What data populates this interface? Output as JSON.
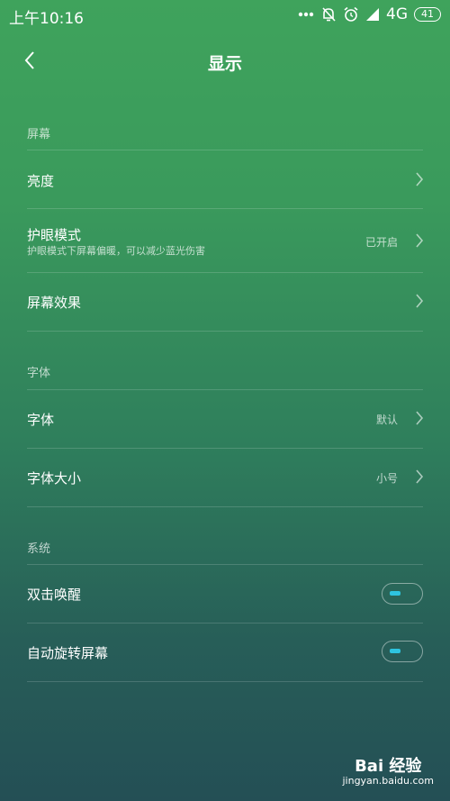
{
  "status_bar": {
    "time": "上午10:16",
    "network": "4G",
    "battery": "41",
    "icons": [
      "more-icon",
      "notification-off-icon",
      "alarm-icon",
      "signal-icon"
    ]
  },
  "header": {
    "title": "显示",
    "back_icon": "chevron-left-icon"
  },
  "sections": {
    "screen": {
      "label": "屏幕",
      "brightness": {
        "label": "亮度"
      },
      "eye_care": {
        "label": "护眼模式",
        "subtitle": "护眼模式下屏幕偏暖，可以减少蓝光伤害",
        "value": "已开启"
      },
      "screen_effect": {
        "label": "屏幕效果"
      }
    },
    "font": {
      "label": "字体",
      "font_item": {
        "label": "字体",
        "value": "默认"
      },
      "font_size": {
        "label": "字体大小",
        "value": "小号"
      }
    },
    "system": {
      "label": "系统",
      "double_tap": {
        "label": "双击唤醒",
        "state": "off"
      },
      "auto_rotate": {
        "label": "自动旋转屏幕",
        "state": "off"
      }
    }
  },
  "watermark": {
    "brand": "Bai 经验",
    "url": "jingyan.baidu.com"
  },
  "colors": {
    "toggle_accent": "#2ec4e0"
  }
}
